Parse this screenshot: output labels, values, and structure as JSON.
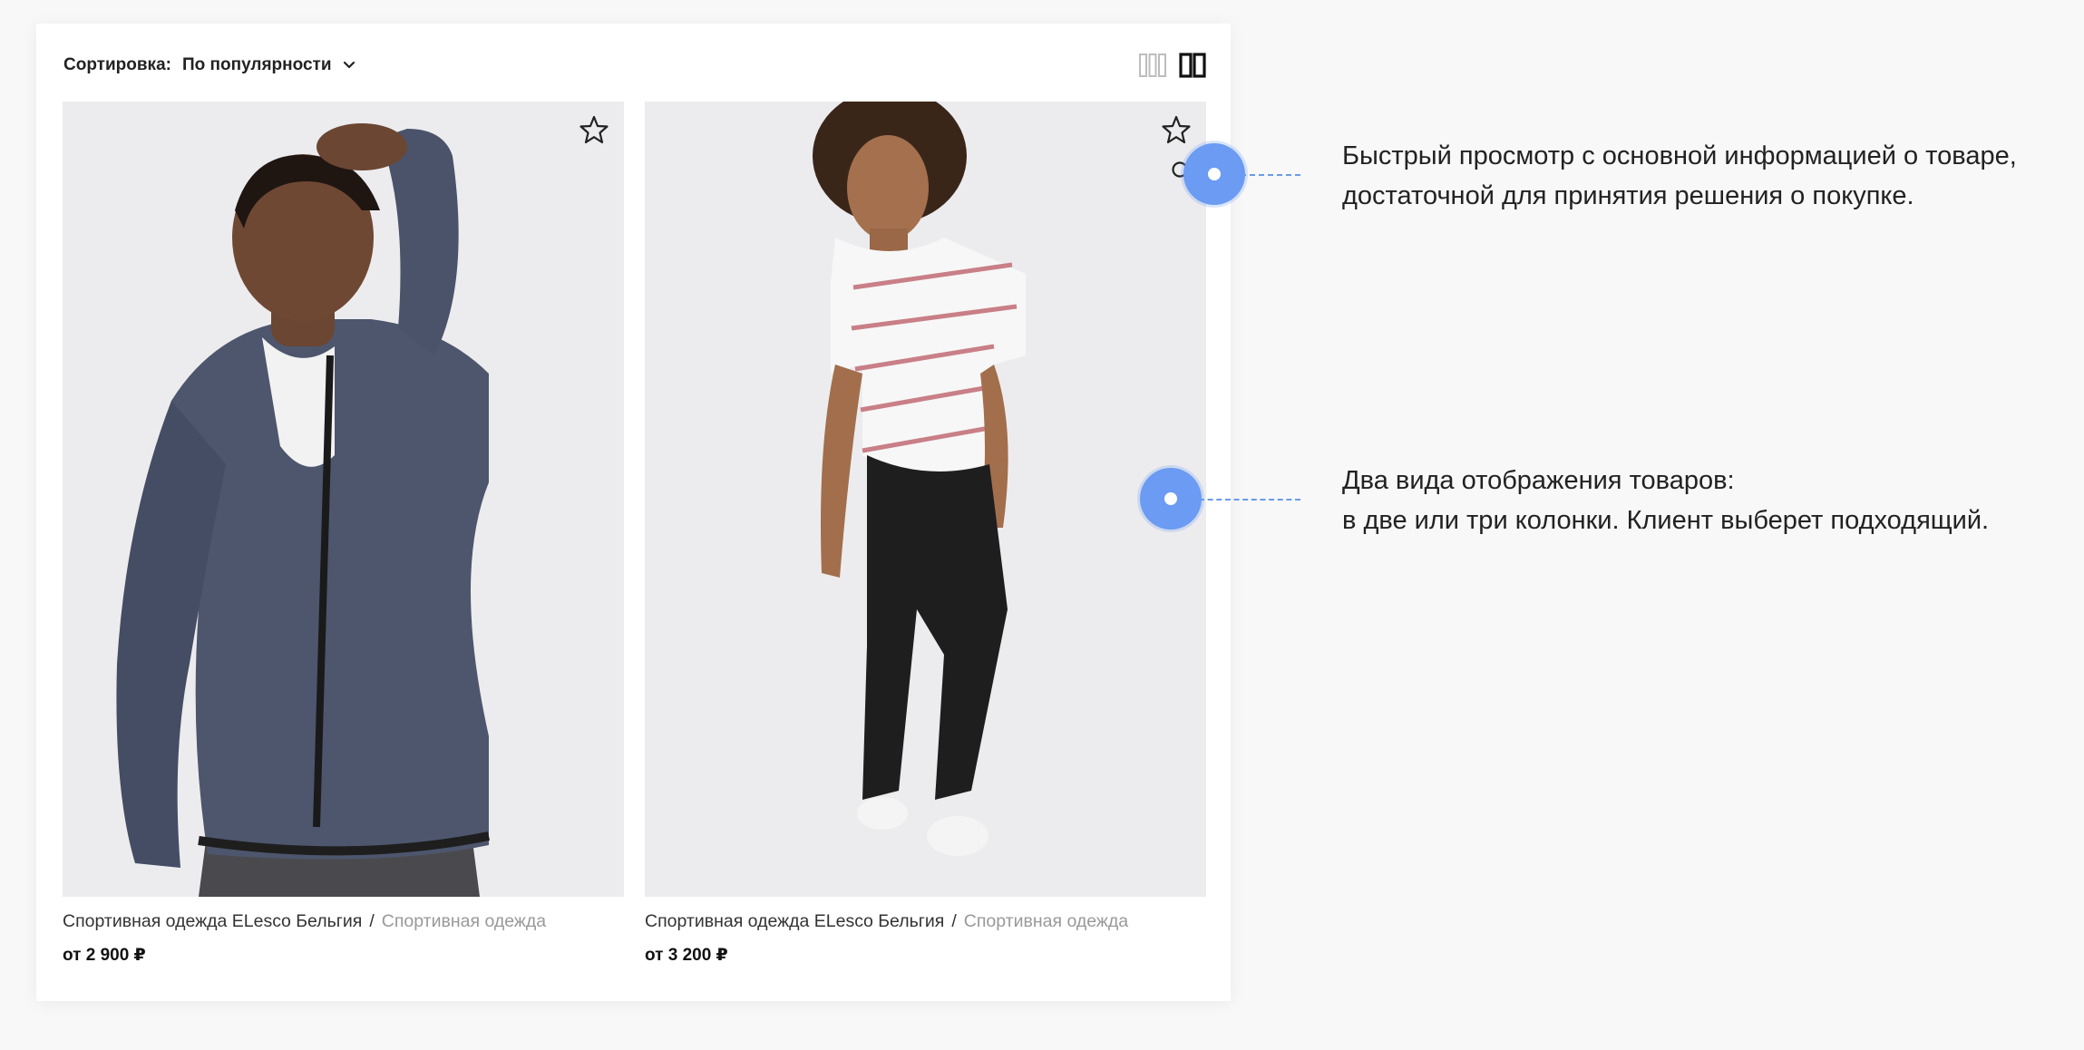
{
  "toolbar": {
    "sort_label": "Сортировка:",
    "sort_value": "По популярности",
    "sort_chevron_icon": "chevron-down-icon",
    "view_three_columns_icon": "grid-three-columns-icon",
    "view_two_columns_icon": "grid-two-columns-icon"
  },
  "products": [
    {
      "name": "Спортивная одежда ELesco Бельгия",
      "separator": "/",
      "category": "Спортивная одежда",
      "price": "от 2 900 ₽",
      "favorite_icon": "star-outline-icon",
      "photo": "man-grey-zip-hoodie-photo"
    },
    {
      "name": "Спортивная одежда ELesco Бельгия",
      "separator": "/",
      "category": "Спортивная одежда",
      "price": "от 3 200 ₽",
      "favorite_icon": "star-outline-icon",
      "quickview_icon": "search-icon",
      "photo": "man-striped-tshirt-joggers-photo"
    }
  ],
  "callouts": [
    {
      "line1": "Быстрый просмотр с основной информацией о товаре,",
      "line2": "достаточной для принятия решения о покупке."
    },
    {
      "line1": "Два вида отображения товаров:",
      "line2": "в две или три колонки. Клиент выберет подходящий."
    }
  ],
  "colors": {
    "background": "#f8f8f8",
    "panel": "#ffffff",
    "accent": "#6b9bf2",
    "muted_text": "#999999",
    "photo_bg": "#ececee"
  }
}
